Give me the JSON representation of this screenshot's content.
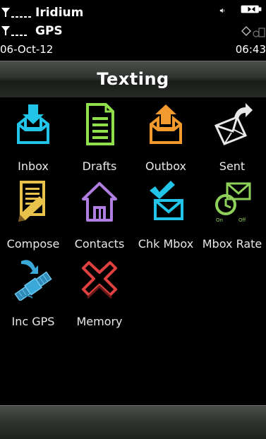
{
  "status": {
    "network_1": "Iridium",
    "network_2": "GPS",
    "date": "06-Oct-12",
    "time": "06:43"
  },
  "title": "Texting",
  "icons": {
    "signal": "signal-bars-icon",
    "sound": "speaker-icon",
    "battery": "battery-icon",
    "gps_status": "gps-satellite-icon"
  },
  "items": [
    {
      "label": "Inbox",
      "icon": "inbox-icon",
      "color": "#22c4e8"
    },
    {
      "label": "Drafts",
      "icon": "drafts-icon",
      "color": "#8fe04a"
    },
    {
      "label": "Outbox",
      "icon": "outbox-icon",
      "color": "#f29a2e"
    },
    {
      "label": "Sent",
      "icon": "sent-icon",
      "color": "#e0e0e0"
    },
    {
      "label": "Compose",
      "icon": "compose-icon",
      "color": "#e8c24a"
    },
    {
      "label": "Contacts",
      "icon": "contacts-icon",
      "color": "#b07de0"
    },
    {
      "label": "Chk Mbox",
      "icon": "check-mailbox-icon",
      "color": "#22c4e8"
    },
    {
      "label": "Mbox Rate",
      "icon": "mailbox-rate-icon",
      "color": "#8fd05a"
    },
    {
      "label": "Inc GPS",
      "icon": "satellite-icon",
      "color": "#3aa8d8"
    },
    {
      "label": "Memory",
      "icon": "memory-delete-icon",
      "color": "#e04040"
    }
  ]
}
